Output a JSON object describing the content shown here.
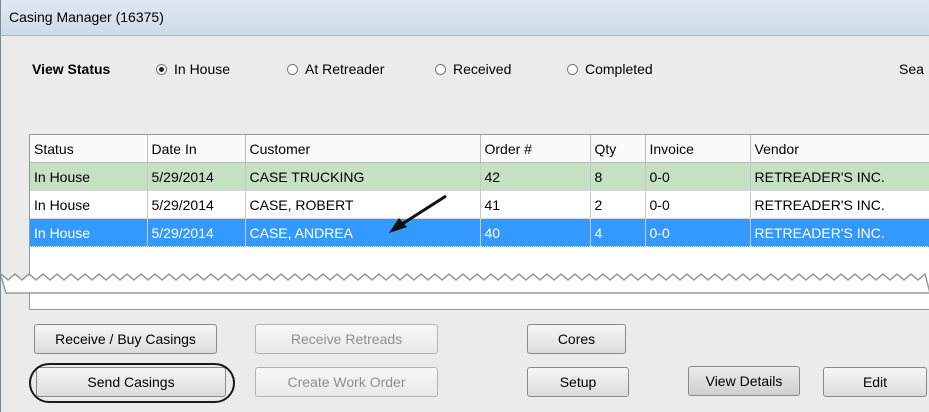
{
  "window": {
    "title": "Casing Manager (16375)"
  },
  "view_status": {
    "label": "View Status",
    "options": [
      "In House",
      "At Retreader",
      "Received",
      "Completed"
    ],
    "selected": "In House"
  },
  "search_label": "Sea",
  "table": {
    "columns": [
      "Status",
      "Date In",
      "Customer",
      "Order #",
      "Qty",
      "Invoice",
      "Vendor"
    ],
    "rows": [
      [
        "In House",
        "5/29/2014",
        "CASE TRUCKING",
        "42",
        "8",
        "0-0",
        "RETREADER'S INC."
      ],
      [
        "In House",
        "5/29/2014",
        "CASE, ROBERT",
        "41",
        "2",
        "0-0",
        "RETREADER'S INC."
      ],
      [
        "In House",
        "5/29/2014",
        "CASE, ANDREA",
        "40",
        "4",
        "0-0",
        "RETREADER'S INC."
      ]
    ]
  },
  "buttons": {
    "receive_buy": "Receive / Buy Casings",
    "receive_retreads": "Receive Retreads",
    "cores": "Cores",
    "send_casings": "Send Casings",
    "create_work_order": "Create Work Order",
    "setup": "Setup",
    "view_details": "View Details",
    "edit": "Edit"
  },
  "colors": {
    "selected_row": "#3399ff",
    "highlight_row": "#c6e0c3"
  }
}
